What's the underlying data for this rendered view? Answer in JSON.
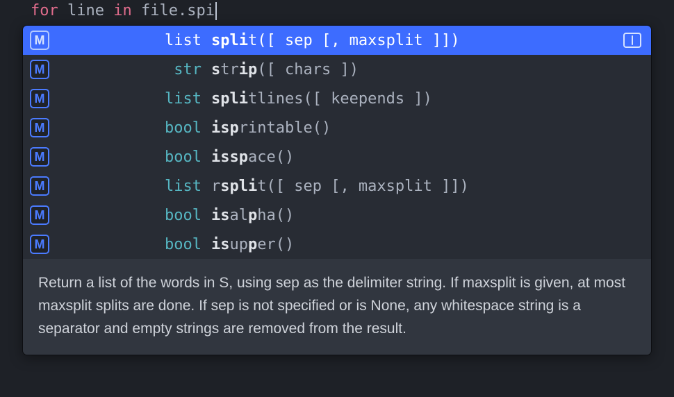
{
  "code": {
    "k_for": "for",
    "v_line": "line",
    "k_in": "in",
    "v_file": "file",
    "dot": ".",
    "partial": "spi"
  },
  "suggestions": [
    {
      "type": "list",
      "name": "split",
      "sig": "([ sep [, maxsplit ]])",
      "bold": [
        [
          0,
          2
        ],
        [
          2,
          3
        ],
        [
          3,
          4
        ]
      ],
      "selected": true
    },
    {
      "type": "str",
      "name": "strip",
      "sig": "([ chars ])",
      "bold": [
        [
          0,
          1
        ],
        [
          3,
          5
        ]
      ]
    },
    {
      "type": "list",
      "name": "splitlines",
      "sig": "([ keepends ])",
      "bold": [
        [
          0,
          4
        ]
      ]
    },
    {
      "type": "bool",
      "name": "isprintable",
      "sig": "()",
      "bold": [
        [
          0,
          3
        ]
      ]
    },
    {
      "type": "bool",
      "name": "isspace",
      "sig": "()",
      "bold": [
        [
          0,
          4
        ]
      ]
    },
    {
      "type": "list",
      "name": "rsplit",
      "sig": "([ sep [, maxsplit ]])",
      "bold": [
        [
          1,
          5
        ]
      ]
    },
    {
      "type": "bool",
      "name": "isalpha",
      "sig": "()",
      "bold": [
        [
          0,
          2
        ],
        [
          4,
          5
        ]
      ]
    },
    {
      "type": "bool",
      "name": "isupper",
      "sig": "()",
      "bold": [
        [
          0,
          2
        ],
        [
          4,
          5
        ]
      ]
    }
  ],
  "icon_letter": "M",
  "doc": "Return a list of the words in S, using sep as the delimiter string. If maxsplit is given, at most maxsplit splits are done. If sep is not specified or is None, any whitespace string is a separator and empty strings are removed from the result."
}
